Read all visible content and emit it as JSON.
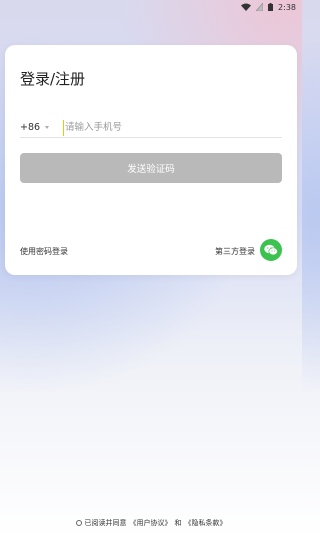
{
  "status_bar": {
    "time": "2:38",
    "icons": [
      "wifi-icon",
      "signal-icon",
      "battery-icon"
    ]
  },
  "login": {
    "title": "登录/注册",
    "country_code": "+86",
    "phone_placeholder": "请输入手机号",
    "send_code_label": "发送验证码",
    "password_login_label": "使用密码登录",
    "third_party_label": "第三方登录",
    "third_party_icon": "wechat-icon"
  },
  "agreement": {
    "text_prefix": "已阅读并同意",
    "user_agreement": "《用户协议》",
    "and": "和",
    "privacy_policy": "《隐私条款》"
  },
  "colors": {
    "button_disabled": "#b9b9b9",
    "wechat_green": "#3cc24e",
    "cursor": "#f1c40f"
  }
}
